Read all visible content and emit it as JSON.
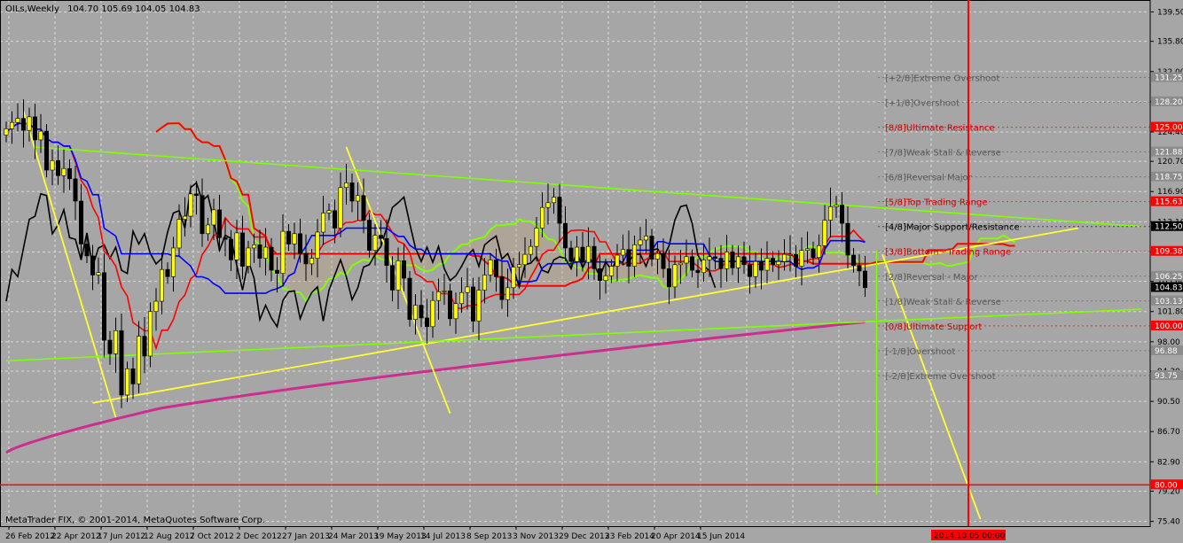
{
  "header": {
    "symbol": "OILs,Weekly",
    "ohlc": "104.70 105.69 104.05 104.83"
  },
  "footer": {
    "copyright": "MetaTrader FIX, © 2001-2014, MetaQuotes Software Corp."
  },
  "colors": {
    "background": "#a6a6a6",
    "grid": "#d9d9d9",
    "bull_candle": "#ffff00",
    "bear_candle": "#000000",
    "red_line": "#ff0000",
    "blue_line": "#0000ff",
    "green_line": "#7fff00",
    "ma_long": "#cc2d8f",
    "trendline": "#ffff33",
    "label_red": "#cc0000",
    "label_gray": "#595959"
  },
  "chart_data": {
    "type": "candlestick",
    "yticks": [
      "139.50",
      "135.80",
      "132.00",
      "128.20",
      "124.40",
      "120.70",
      "116.90",
      "113.10",
      "109.30",
      "105.60",
      "101.80",
      "98.00",
      "94.30",
      "90.50",
      "86.70",
      "82.90",
      "79.20",
      "75.40"
    ],
    "xticks": [
      "26 Feb 2012",
      "22 Apr 2012",
      "17 Jun 2012",
      "12 Aug 2012",
      "7 Oct 2012",
      "2 Dec 2012",
      "27 Jan 2013",
      "24 Mar 2013",
      "19 May 2013",
      "14 Jul 2013",
      "8 Sep 2013",
      "3 Nov 2013",
      "29 Dec 2013",
      "23 Feb 2014",
      "20 Apr 2014",
      "15 Jun 2014"
    ],
    "ylim": [
      74.8,
      141.0
    ],
    "current_price": "104.83",
    "cursor_date": "2014.10.05 00:00",
    "price_tags": [
      {
        "label": "131.25",
        "value": 131.25,
        "style": "gray"
      },
      {
        "label": "128.20",
        "value": 128.2,
        "style": "gray"
      },
      {
        "label": "125.00",
        "value": 125.0,
        "style": "red"
      },
      {
        "label": "121.88",
        "value": 121.88,
        "style": "gray"
      },
      {
        "label": "118.75",
        "value": 118.75,
        "style": "gray"
      },
      {
        "label": "115.63",
        "value": 115.63,
        "style": "red"
      },
      {
        "label": "112.50",
        "value": 112.5,
        "style": "black"
      },
      {
        "label": "109.38",
        "value": 109.38,
        "style": "red"
      },
      {
        "label": "106.25",
        "value": 106.25,
        "style": "gray"
      },
      {
        "label": "104.83",
        "value": 104.83,
        "style": "black"
      },
      {
        "label": "103.13",
        "value": 103.13,
        "style": "gray"
      },
      {
        "label": "100.00",
        "value": 100.0,
        "style": "red"
      },
      {
        "label": "96.88",
        "value": 96.88,
        "style": "gray"
      },
      {
        "label": "93.75",
        "value": 93.75,
        "style": "gray"
      },
      {
        "label": "80.00",
        "value": 80.0,
        "style": "red"
      }
    ],
    "murrey_levels": [
      {
        "text": "[+2/8]Extreme Overshoot",
        "value": 131.25,
        "color": "#595959"
      },
      {
        "text": "[+1/8]Overshoot",
        "value": 128.13,
        "color": "#595959"
      },
      {
        "text": "[8/8]Ultimate Resistance",
        "value": 125.0,
        "color": "#cc0000"
      },
      {
        "text": "[7/8]Weak Stall & Reverse",
        "value": 121.88,
        "color": "#595959"
      },
      {
        "text": "[6/8]Reversal Major",
        "value": 118.75,
        "color": "#595959"
      },
      {
        "text": "[5/8]Top Trading Range",
        "value": 115.63,
        "color": "#cc0000"
      },
      {
        "text": "[4/8]Major Support/Resistance",
        "value": 112.5,
        "color": "#000000"
      },
      {
        "text": "[3/8]Bottom - Trading Range",
        "value": 109.38,
        "color": "#cc0000"
      },
      {
        "text": "[2/8]Reversal - Major",
        "value": 106.25,
        "color": "#595959"
      },
      {
        "text": "[1/8]Weak Stall & Reverse",
        "value": 103.13,
        "color": "#595959"
      },
      {
        "text": "[0/8]Ultimate Support",
        "value": 100.0,
        "color": "#cc0000"
      },
      {
        "text": "[-1/8]Overshoot",
        "value": 96.88,
        "color": "#595959"
      },
      {
        "text": "[-2/8]Extreme Overshoot",
        "value": 93.75,
        "color": "#595959"
      }
    ],
    "horizontal_line": 80.0,
    "series": [
      {
        "name": "",
        "closes": [
          124.8,
          125.6,
          126.1,
          124.6,
          126.3,
          123.4,
          124.5,
          119.6,
          120.8,
          118.9,
          119.8,
          118.5,
          115.7,
          110.3,
          108.8,
          106.4,
          106.7,
          98.2,
          96.5,
          99.4,
          91.3,
          94.6,
          92.7,
          98.7,
          96.2,
          101.8,
          103.1,
          107.1,
          106.2,
          109.8,
          113.4,
          113.8,
          116.6,
          116.4,
          111.6,
          112.7,
          114.6,
          111.1,
          110.9,
          108.3,
          111.7,
          107.5,
          109.8,
          110.2,
          108.5,
          109.9,
          107.0,
          106.6,
          111.9,
          110.3,
          111.6,
          109.1,
          107.8,
          108.5,
          111.8,
          114.2,
          114.5,
          112.3,
          117.4,
          118.0,
          115.7,
          116.4,
          113.3,
          109.5,
          111.4,
          111.0,
          107.6,
          104.5,
          108.2,
          106.0,
          100.8,
          102.6,
          101.0,
          99.9,
          103.2,
          104.3,
          104.4,
          100.9,
          102.8,
          104.2,
          104.9,
          100.6,
          104.5,
          106.4,
          108.3,
          106.2,
          103.3,
          104.8,
          107.4,
          107.7,
          109.0,
          110.0,
          112.3,
          114.9,
          115.5,
          116.2,
          112.9,
          109.8,
          108.1,
          109.9,
          108.0,
          110.0,
          107.2,
          105.7,
          106.3,
          107.5,
          108.9,
          109.6,
          107.5,
          110.2,
          110.8,
          111.3,
          108.4,
          109.1,
          107.2,
          104.9,
          107.7,
          107.9,
          108.7,
          107.0,
          106.7,
          108.3,
          108.7,
          108.5,
          107.2,
          109.3,
          107.3,
          108.7,
          107.7,
          106.2,
          108.1,
          107.0,
          108.5,
          107.7,
          108.1,
          109.0,
          109.0,
          107.5,
          109.5,
          109.7,
          108.6,
          110.1,
          113.3,
          115.0,
          115.2,
          112.9,
          108.9,
          107.6,
          106.9,
          104.8
        ]
      }
    ]
  }
}
